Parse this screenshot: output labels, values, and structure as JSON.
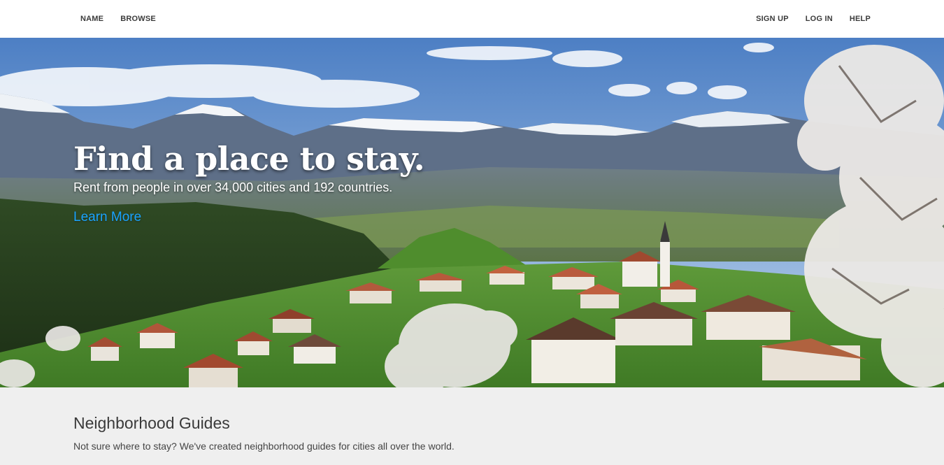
{
  "nav": {
    "left": [
      {
        "label": "NAME"
      },
      {
        "label": "BROWSE"
      }
    ],
    "right": [
      {
        "label": "SIGN UP"
      },
      {
        "label": "LOG IN"
      },
      {
        "label": "HELP"
      }
    ]
  },
  "hero": {
    "title": "Find a place to stay.",
    "subtitle": "Rent from people in over 34,000 cities and 192 countries.",
    "link_label": "Learn More"
  },
  "guides": {
    "heading": "Neighborhood Guides",
    "description": "Not sure where to stay? We've created neighborhood guides for cities all over the world."
  },
  "colors": {
    "link": "#1aa3ff",
    "guides_bg": "#efefef",
    "nav_text": "#3b3b3b"
  }
}
